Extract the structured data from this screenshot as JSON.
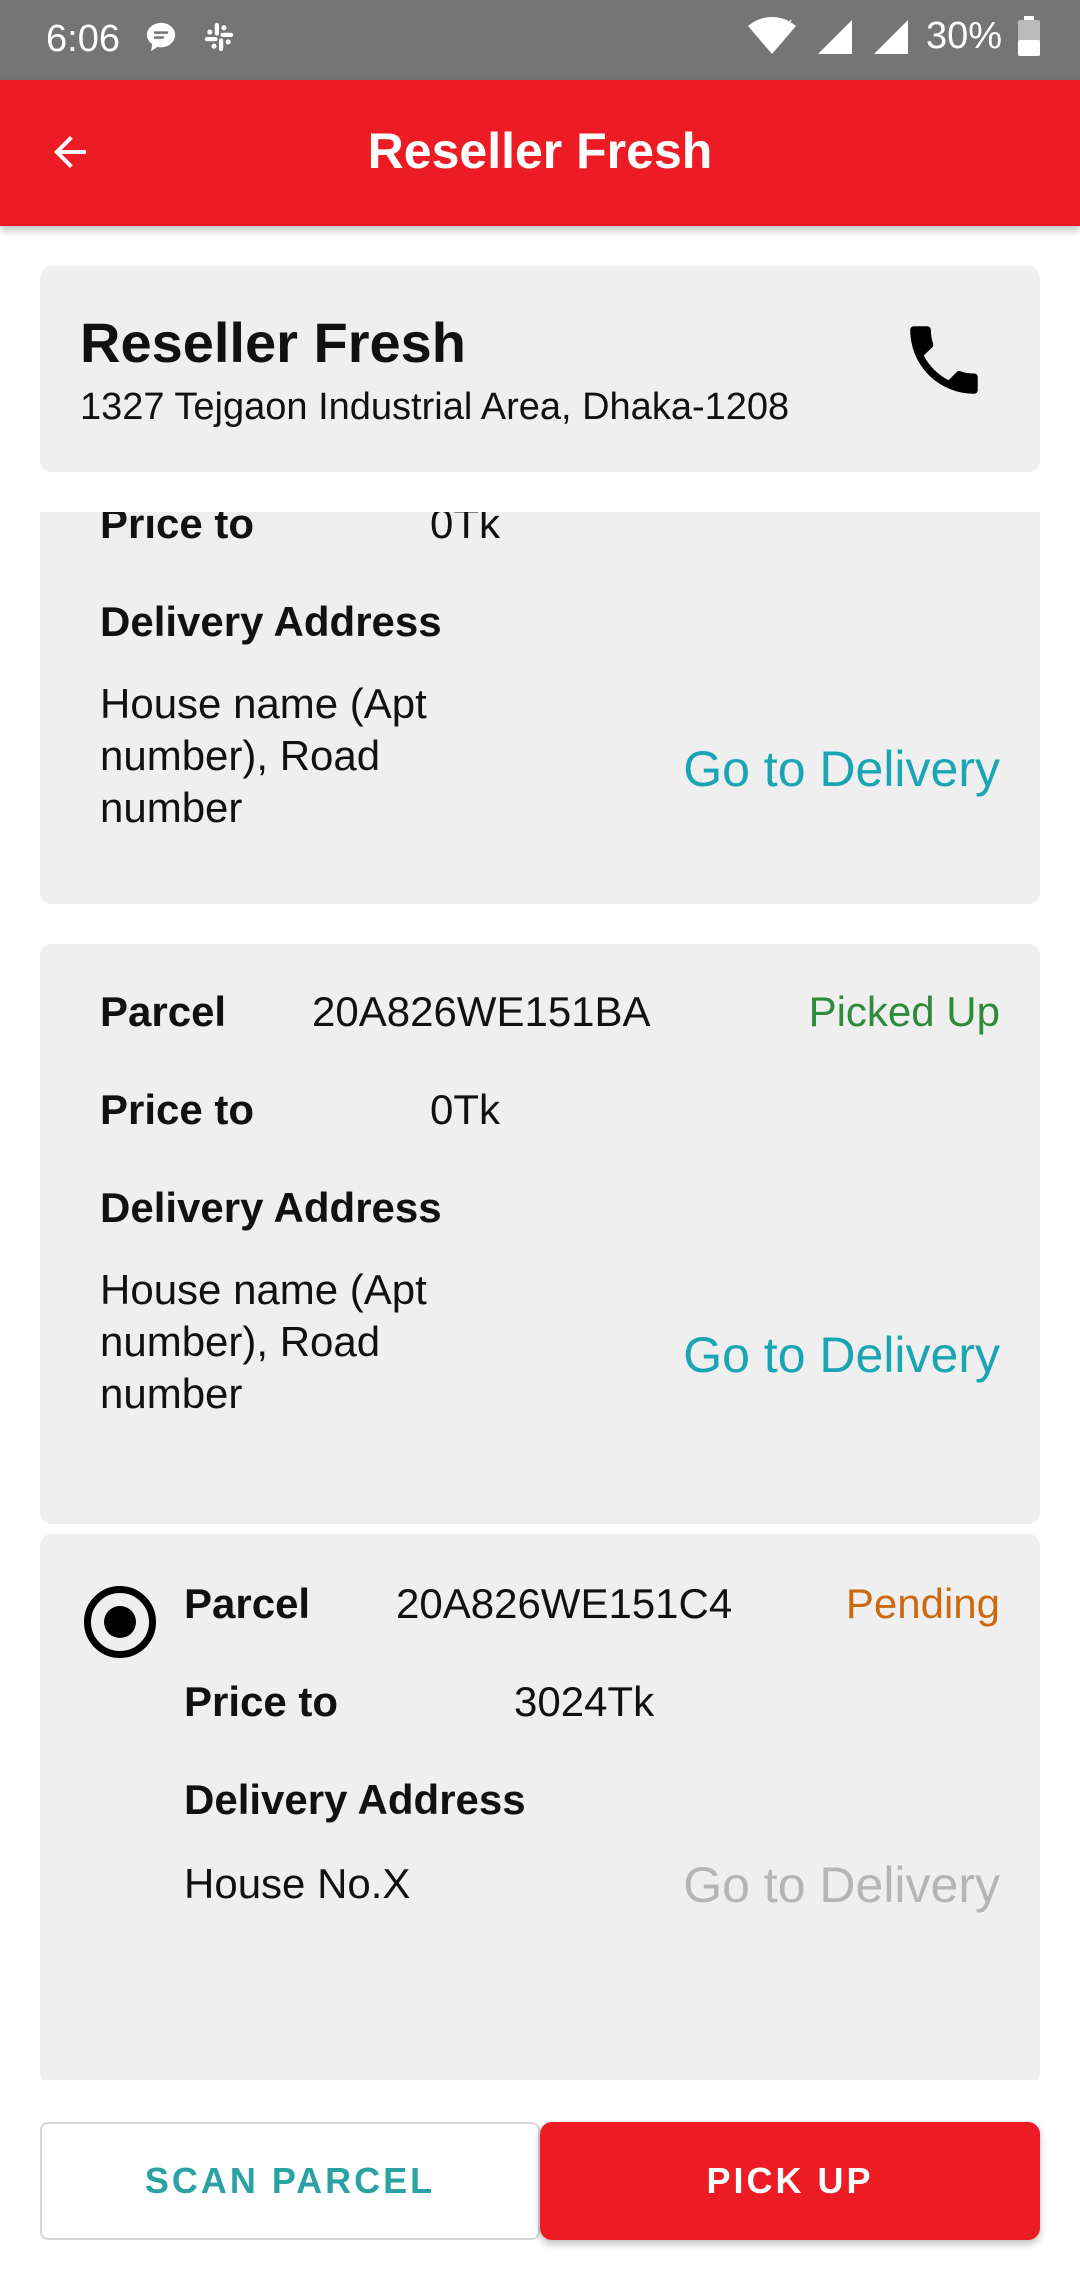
{
  "status_bar": {
    "time": "6:06",
    "battery": "30%"
  },
  "app_bar": {
    "title": "Reseller Fresh"
  },
  "shop": {
    "name": "Reseller Fresh",
    "address": "1327 Tejgaon Industrial Area, Dhaka-1208"
  },
  "labels": {
    "parcel": "Parcel",
    "price_to": "Price to",
    "delivery_address": "Delivery Address",
    "go_to_delivery": "Go to Delivery"
  },
  "parcels": [
    {
      "id": "",
      "status": "",
      "price": "0Tk",
      "address": "House name (Apt number), Road number"
    },
    {
      "id": "20A826WE151BA",
      "status": "Picked Up",
      "price": "0Tk",
      "address": "House name (Apt number), Road number"
    },
    {
      "id": "20A826WE151C4",
      "status": "Pending",
      "price": "3024Tk",
      "address": "House No.X"
    }
  ],
  "colors": {
    "brand_red": "#ed1c24",
    "picked_up": "#2e8b3a",
    "pending": "#cc6a10",
    "link": "#1aa5b5",
    "disabled": "#b5b5b5"
  },
  "buttons": {
    "scan_parcel": "SCAN PARCEL",
    "pick_up": "PICK UP"
  }
}
